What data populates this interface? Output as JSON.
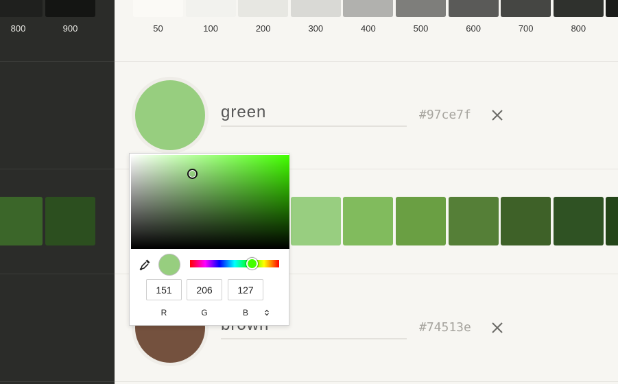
{
  "shades": {
    "labels": [
      "50",
      "100",
      "200",
      "300",
      "400",
      "500",
      "600",
      "700",
      "800",
      "900"
    ],
    "neutral_colors": [
      "#fbfaf6",
      "#f2f2ee",
      "#e7e7e2",
      "#d9d9d5",
      "#b1b1ae",
      "#7e7e7b",
      "#5a5a58",
      "#454643",
      "#2f312d",
      "#1b1c1a"
    ],
    "green_colors": [
      "#dcefd2",
      "#c8e8bb",
      "#b0e1a5",
      "#98ce80",
      "#81bb5d",
      "#6a9f43",
      "#557f37",
      "#3e6128",
      "#2f5223",
      "#244519"
    ]
  },
  "colors": [
    {
      "name": "green",
      "hex": "#97ce7f",
      "delete_icon": "close-icon"
    },
    {
      "name": "brown",
      "hex": "#74513e",
      "delete_icon": "close-icon"
    }
  ],
  "picker": {
    "rgb": {
      "r": "151",
      "g": "206",
      "b": "127"
    },
    "labels": {
      "r": "R",
      "g": "G",
      "b": "B"
    },
    "hue_color": "#42ff00",
    "hue_fraction": 0.68,
    "eyedropper_icon": "eyedropper-icon",
    "mode_toggle_icon": "chevron-up-down-icon"
  }
}
